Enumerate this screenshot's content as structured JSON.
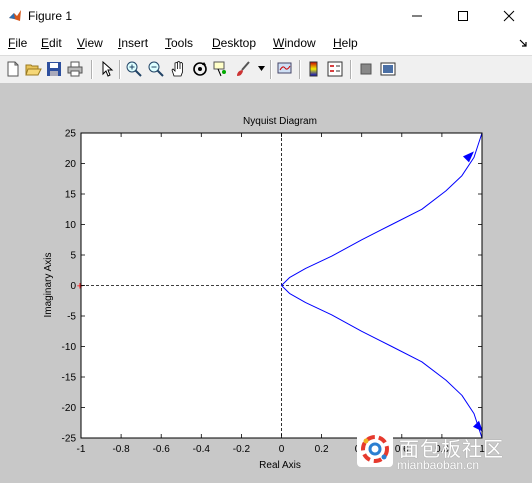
{
  "window": {
    "title": "Figure 1"
  },
  "menu": [
    {
      "first": "F",
      "rest": "ile"
    },
    {
      "first": "E",
      "rest": "dit"
    },
    {
      "first": "V",
      "rest": "iew"
    },
    {
      "first": "I",
      "rest": "nsert"
    },
    {
      "first": "T",
      "rest": "ools"
    },
    {
      "first": "D",
      "rest": "esktop"
    },
    {
      "first": "W",
      "rest": "indow"
    },
    {
      "first": "H",
      "rest": "elp"
    }
  ],
  "toolbar": {
    "icons": [
      "new-figure-icon",
      "open-file-icon",
      "save-icon",
      "print-icon",
      "edit-plot-arrow-icon",
      "zoom-in-icon",
      "zoom-out-icon",
      "pan-hand-icon",
      "rotate-3d-icon",
      "data-cursor-icon",
      "brush-icon",
      "dropdown-arrow-icon",
      "link-plot-icon",
      "colorbar-icon",
      "legend-icon",
      "hide-plot-tools-icon",
      "show-plot-tools-icon"
    ]
  },
  "chart_data": {
    "type": "line",
    "title": "Nyquist Diagram",
    "xlabel": "Real Axis",
    "ylabel": "Imaginary Axis",
    "xlim": [
      -1,
      1
    ],
    "ylim": [
      -25,
      25
    ],
    "xticks": [
      "-1",
      "-0.8",
      "-0.6",
      "-0.4",
      "-0.2",
      "0",
      "0.2",
      "0.4",
      "0.6",
      "0.8",
      "1"
    ],
    "yticks": [
      "25",
      "20",
      "15",
      "10",
      "5",
      "0",
      "-5",
      "-10",
      "-15",
      "-20",
      "-25"
    ],
    "series": [
      {
        "color": "#0000ff",
        "points": [
          [
            1.0,
            25
          ],
          [
            0.96,
            21
          ],
          [
            0.9,
            18
          ],
          [
            0.82,
            15.5
          ],
          [
            0.7,
            12.5
          ],
          [
            0.55,
            10
          ],
          [
            0.4,
            7.5
          ],
          [
            0.25,
            4.8
          ],
          [
            0.12,
            2.8
          ],
          [
            0.04,
            1.3
          ],
          [
            0.0,
            0
          ],
          [
            0.04,
            -1.3
          ],
          [
            0.12,
            -2.8
          ],
          [
            0.25,
            -4.8
          ],
          [
            0.4,
            -7.5
          ],
          [
            0.55,
            -10
          ],
          [
            0.7,
            -12.5
          ],
          [
            0.82,
            -15.5
          ],
          [
            0.9,
            -18
          ],
          [
            0.96,
            -21
          ],
          [
            1.0,
            -25
          ]
        ],
        "arrows": [
          [
            0.93,
            21
          ],
          [
            0.98,
            -23
          ]
        ]
      }
    ],
    "critical_point": [
      -1,
      0
    ],
    "critical_point_color": "#ff0000",
    "reference_lines": {
      "x": 0,
      "y": 0
    }
  },
  "watermark": {
    "cn": "面包板社区",
    "en": "mianbaoban.cn"
  }
}
